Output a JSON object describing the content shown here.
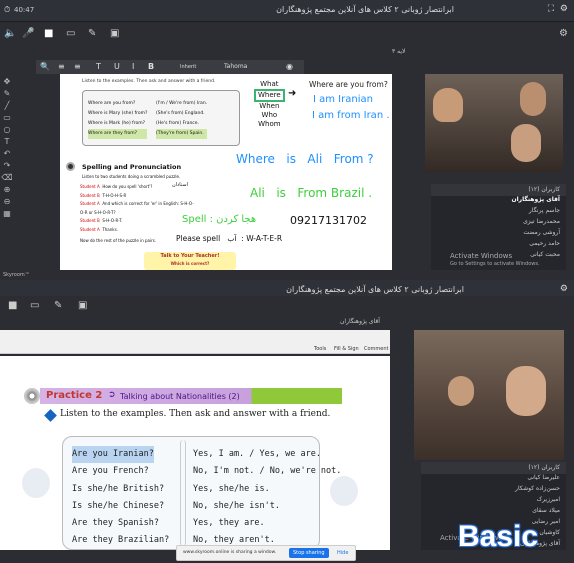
{
  "top": {
    "time": "40:47",
    "title": "ابرانتصار ژوبانی ۲ کلاس های آنلاین مجتمع پژوهنگاران",
    "layer": "لایه ۳",
    "fmt": {
      "b": "B",
      "i": "I",
      "u": "U",
      "t": "T",
      "font": "Tahoma",
      "size": "Inherit"
    }
  },
  "slide1": {
    "listen": "Listen to the examples. Then ask and answer with a friend.",
    "qa": [
      [
        "Where are you from?",
        "(I'm / We're from) Iran."
      ],
      [
        "Where is Mary (she) from?",
        "(She's from) England."
      ],
      [
        "Where is Mark (he) from?",
        "(He's from) France."
      ],
      [
        "Where are they from?",
        "(They're from) Spain."
      ]
    ],
    "wh": [
      "What",
      "Where",
      "When",
      "Who",
      "Whom"
    ],
    "q": "Where are you from?",
    "a1": "I am Iranian",
    "a2": "I am from Iran .",
    "w1": [
      "Where",
      "is",
      "Ali",
      "From ?"
    ],
    "w2": [
      "Ali",
      "is",
      "From Brazil ."
    ],
    "sp_title": "Spelling and Pronunciation",
    "sp_sub": "Listen to two students doing a scrambled puzzle.",
    "students": [
      [
        "Student A",
        "How do you spell 'short'?"
      ],
      [
        "Student B",
        "T-H-O-H-S-R"
      ],
      [
        "Student A",
        "And which is correct for 'er' in English: S-H-O-O-R or S-H-O-R-T?"
      ],
      [
        "Student B",
        "S-H-O-R-T."
      ],
      [
        "Student A",
        "Thanks."
      ]
    ],
    "sp_now": "Now do the rest of the puzzle in pairs.",
    "spell_fa": "هجا کردن : Spell",
    "phone": "09217131702",
    "spell_please": "Please spell",
    "ab": "آب",
    "water": ": W-A-T-E-R",
    "note": "Talk to Your Teacher!",
    "note2": "Which is correct?",
    "stud_fa": "استادان"
  },
  "users1": {
    "header": "کاربران (۱۲)",
    "items": [
      "آقای پژوهنگاران",
      "جاسم پرنگار",
      "محمدرضا تیزی",
      "آروشی رمضت",
      "حامد رحیمی",
      "محبت کیانی",
      "میلاد حامد"
    ]
  },
  "watermark": {
    "line1": "Activate Windows",
    "line2": "Go to Settings to activate Windows."
  },
  "skyroom": "Skyroom™",
  "bottom": {
    "title": "ابرانتصار ژوبانی ۲ کلاس های آنلاین مجتمع پژوهنگاران",
    "sub": "آقای پژوهنگاران",
    "tools": "Tools",
    "fill": "Fill & Sign",
    "comment": "Comment"
  },
  "slide2": {
    "practice": "Practice 2",
    "pract_title": "Talking about Nationalities (2)",
    "listen": "Listen to the examples. Then ask and answer with a friend.",
    "rows": [
      [
        "Are you Iranian?",
        "Yes, I am. / Yes, we are."
      ],
      [
        "Are you French?",
        "No, I'm not. / No, we're not."
      ],
      [
        "Is she/he British?",
        "Yes, she/he is."
      ],
      [
        "Is she/he Chinese?",
        "No, she/he isn't."
      ],
      [
        "Are they Spanish?",
        "Yes, they are."
      ],
      [
        "Are they Brazilian?",
        "No, they aren't."
      ]
    ]
  },
  "users2": {
    "header": "کاربران (۱۲)",
    "items": [
      "علیرضا کیانی",
      "حسن‌زاده کوشکار",
      "امیرزیرک",
      "میلاد سقای",
      "امیر رضایی",
      "کاوشیان زاده",
      "آقای پژوهنگاران"
    ]
  },
  "share": {
    "text": "www.skyroom.online is sharing a window.",
    "stop": "Stop sharing",
    "hide": "Hide"
  },
  "logo": "Basic"
}
